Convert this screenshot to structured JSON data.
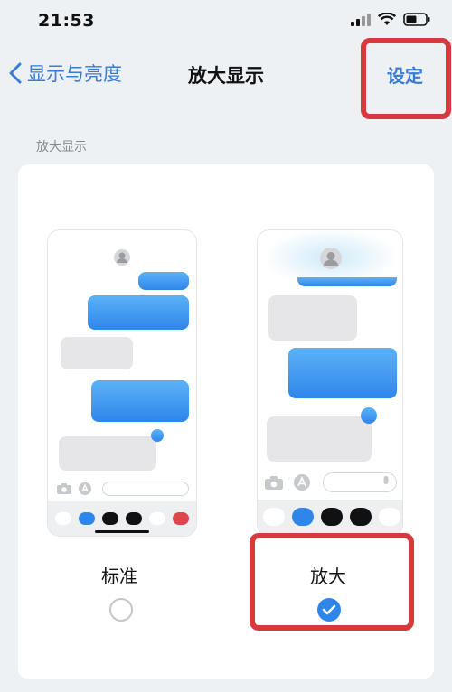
{
  "status_bar": {
    "time": "21:53"
  },
  "nav": {
    "back_label": "显示与亮度",
    "title": "放大显示",
    "action_label": "设定"
  },
  "section": {
    "label": "放大显示"
  },
  "options": [
    {
      "label": "标准",
      "selected": false
    },
    {
      "label": "放大",
      "selected": true
    }
  ],
  "colors": {
    "accent": "#3a7bd5",
    "highlight_box": "#d63a3f",
    "bubble_blue": "#2f86ea",
    "bubble_gray": "#e6e6e8"
  },
  "icons": [
    "signal-icon",
    "wifi-icon",
    "battery-icon",
    "chevron-left-icon",
    "avatar-icon",
    "camera-icon",
    "app-store-icon",
    "mic-icon",
    "checkmark-icon"
  ]
}
